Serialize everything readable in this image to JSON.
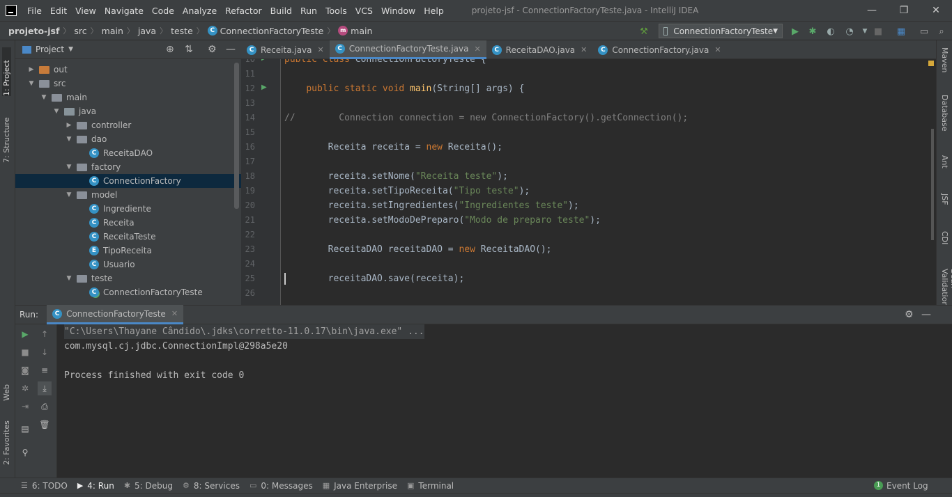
{
  "menubar": {
    "items": [
      "File",
      "Edit",
      "View",
      "Navigate",
      "Code",
      "Analyze",
      "Refactor",
      "Build",
      "Run",
      "Tools",
      "VCS",
      "Window",
      "Help"
    ],
    "window_title": "projeto-jsf - ConnectionFactoryTeste.java - IntelliJ IDEA"
  },
  "breadcrumbs": [
    "projeto-jsf",
    "src",
    "main",
    "java",
    "teste",
    "ConnectionFactoryTeste",
    "main"
  ],
  "run_config": {
    "label": "ConnectionFactoryTeste"
  },
  "left_strip": {
    "project": "1: Project",
    "structure": "7: Structure",
    "web": "Web",
    "favorites": "2: Favorites"
  },
  "right_strip": [
    "Maven",
    "Database",
    "Ant",
    "JSF",
    "CDI",
    "Bean Validation"
  ],
  "project_panel": {
    "title": "Project",
    "tree": [
      {
        "label": "out",
        "depth": 1,
        "kind": "folder-orange",
        "arrow": "▶"
      },
      {
        "label": "src",
        "depth": 1,
        "kind": "folder",
        "arrow": "▼"
      },
      {
        "label": "main",
        "depth": 2,
        "kind": "folder",
        "arrow": "▼"
      },
      {
        "label": "java",
        "depth": 3,
        "kind": "folder-blue",
        "arrow": "▼"
      },
      {
        "label": "controller",
        "depth": 4,
        "kind": "folder",
        "arrow": "▶"
      },
      {
        "label": "dao",
        "depth": 4,
        "kind": "folder",
        "arrow": "▼"
      },
      {
        "label": "ReceitaDAO",
        "depth": 5,
        "kind": "class",
        "arrow": ""
      },
      {
        "label": "factory",
        "depth": 4,
        "kind": "folder",
        "arrow": "▼"
      },
      {
        "label": "ConnectionFactory",
        "depth": 5,
        "kind": "class",
        "arrow": "",
        "selected": true
      },
      {
        "label": "model",
        "depth": 4,
        "kind": "folder",
        "arrow": "▼"
      },
      {
        "label": "Ingrediente",
        "depth": 5,
        "kind": "class",
        "arrow": ""
      },
      {
        "label": "Receita",
        "depth": 5,
        "kind": "class",
        "arrow": ""
      },
      {
        "label": "ReceitaTeste",
        "depth": 5,
        "kind": "class",
        "arrow": ""
      },
      {
        "label": "TipoReceita",
        "depth": 5,
        "kind": "enum",
        "arrow": ""
      },
      {
        "label": "Usuario",
        "depth": 5,
        "kind": "class",
        "arrow": ""
      },
      {
        "label": "teste",
        "depth": 4,
        "kind": "folder",
        "arrow": "▼"
      },
      {
        "label": "ConnectionFactoryTeste",
        "depth": 5,
        "kind": "class-run",
        "arrow": ""
      }
    ]
  },
  "editor_tabs": [
    {
      "label": "Receita.java",
      "active": false
    },
    {
      "label": "ConnectionFactoryTeste.java",
      "active": true
    },
    {
      "label": "ReceitaDAO.java",
      "active": false
    },
    {
      "label": "ConnectionFactory.java",
      "active": false
    }
  ],
  "code_lines": [
    {
      "n": "10",
      "html": "<span class='kw'>public class</span> ConnectionFactoryTeste {"
    },
    {
      "n": "11",
      "html": ""
    },
    {
      "n": "12",
      "html": "    <span class='kw'>public static void</span> <span class='mth'>main</span>(String[] args) {"
    },
    {
      "n": "13",
      "html": ""
    },
    {
      "n": "14",
      "html": "<span class='cmt'>//        Connection connection = new ConnectionFactory().getConnection();</span>"
    },
    {
      "n": "15",
      "html": ""
    },
    {
      "n": "16",
      "html": "        Receita receita = <span class='kw'>new</span> Receita();"
    },
    {
      "n": "17",
      "html": ""
    },
    {
      "n": "18",
      "html": "        receita.setNome(<span class='str'>\"Receita teste\"</span>);"
    },
    {
      "n": "19",
      "html": "        receita.setTipoReceita(<span class='str'>\"Tipo teste\"</span>);"
    },
    {
      "n": "20",
      "html": "        receita.setIngredientes(<span class='str'>\"Ingredientes teste\"</span>);"
    },
    {
      "n": "21",
      "html": "        receita.setModoDePreparo(<span class='str'>\"Modo de preparo teste\"</span>);"
    },
    {
      "n": "22",
      "html": ""
    },
    {
      "n": "23",
      "html": "        ReceitaDAO receitaDAO = <span class='kw'>new</span> ReceitaDAO();"
    },
    {
      "n": "24",
      "html": ""
    },
    {
      "n": "25",
      "html": "        receitaDAO.save(receita);"
    },
    {
      "n": "26",
      "html": ""
    }
  ],
  "run_panel": {
    "label": "Run:",
    "tab": "ConnectionFactoryTeste",
    "console": [
      "\"C:\\Users\\Thayane Cândido\\.jdks\\corretto-11.0.17\\bin\\java.exe\" ...",
      "com.mysql.cj.jdbc.ConnectionImpl@298a5e20",
      "",
      "Process finished with exit code 0"
    ]
  },
  "bottom_tabs": [
    "6: TODO",
    "4: Run",
    "5: Debug",
    "8: Services",
    "0: Messages",
    "Java Enterprise",
    "Terminal"
  ],
  "event_log": {
    "label": "Event Log",
    "count": "1"
  },
  "colors": {
    "accent": "#4a88c7",
    "keyword": "#cc7832",
    "string": "#6a8759",
    "method": "#ffc66d"
  }
}
